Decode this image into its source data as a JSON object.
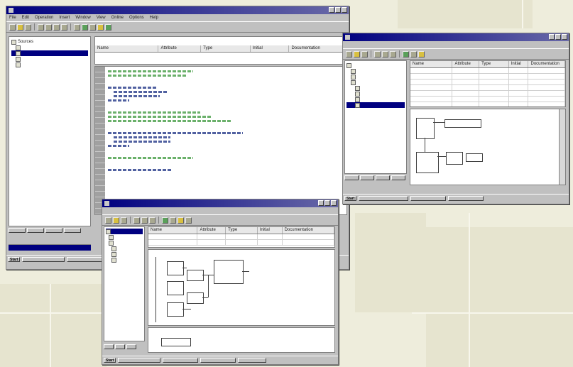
{
  "background": {
    "color": "#eeeddc",
    "tile_color": "#e6e4cf"
  },
  "window1": {
    "title": "",
    "menu": [
      "File",
      "Edit",
      "Operation",
      "Insert",
      "Window",
      "View",
      "Online",
      "Options",
      "Help"
    ],
    "tree": {
      "root": "Sources",
      "items": [
        "",
        "",
        "",
        ""
      ],
      "selected_index": 1
    },
    "editor_header": [
      "Name",
      "Attribute",
      "Type",
      "Initial",
      "Documentation"
    ],
    "code_colors": {
      "comment": "#2a8a2a",
      "code": "#202080"
    }
  },
  "window2": {
    "title": "",
    "header": [
      "Name",
      "Attribute",
      "Type",
      "Initial",
      "Documentation"
    ]
  },
  "window3": {
    "title": "",
    "header": [
      "Name",
      "Attribute",
      "Type",
      "Initial",
      "Documentation"
    ]
  },
  "taskbar": {
    "start_label": "Start"
  }
}
